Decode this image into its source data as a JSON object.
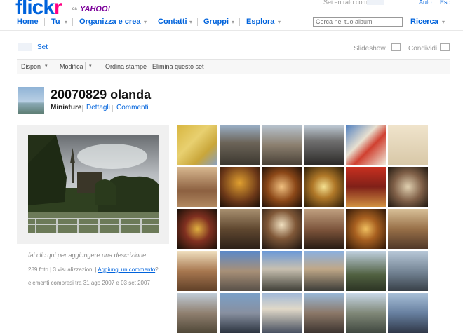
{
  "brand": {
    "logo_main": "flick",
    "logo_accent": "r",
    "logo_partner_prefix": "da",
    "logo_partner": "YAHOO!"
  },
  "account": {
    "signed_in_label": "Sei entrato come",
    "auto_label": "Auto",
    "exit_label": "Esc"
  },
  "nav": {
    "home": "Home",
    "you": "Tu",
    "organize": "Organizza e crea",
    "contacts": "Contatti",
    "groups": "Gruppi",
    "explore": "Esplora"
  },
  "search": {
    "placeholder": "Cerca nel tuo album",
    "button": "Ricerca"
  },
  "breadcrumb": {
    "set_link": "Set"
  },
  "actions": {
    "slideshow": "Slideshow",
    "share": "Condividi"
  },
  "toolbar": {
    "display": "Dispon",
    "edit": "Modifica",
    "order_prints": "Ordina stampe",
    "delete_set": "Elimina questo set"
  },
  "set": {
    "title": "20070829 olanda",
    "tabs": {
      "thumbnails": "Miniature",
      "details": "Dettagli",
      "comments": "Commenti"
    },
    "description_prompt": "fai clic qui per aggiungere una descrizione",
    "stats_prefix": "289 foto | 3 visualizzazioni |",
    "add_comment": "Aggiungi un commento",
    "stats_suffix": "?",
    "date_range": "elementi compresi tra 31 ago 2007 e 03 set 2007"
  },
  "colors": {
    "link_blue": "#0063dc",
    "flickr_pink": "#ff0084",
    "yahoo_purple": "#7b0099"
  },
  "thumbnails": [
    {
      "bg": "linear-gradient(135deg,#d8b640,#e8d070 40%,#c9a63a 70%,#8aa0c0)"
    },
    {
      "bg": "linear-gradient(#9ab0c8 0%,#6c6458 45%,#3c3830 100%)"
    },
    {
      "bg": "linear-gradient(#b8c4d0 0%,#8c8070 50%,#4a4238 100%)"
    },
    {
      "bg": "linear-gradient(#c0ccd8 0%,#707070 40%,#2c2a28 100%)"
    },
    {
      "bg": "linear-gradient(135deg,#5080c0,#e8e0d0 40%,#d04030 60%,#f0e8d8)"
    },
    {
      "bg": "linear-gradient(#f0e4cc,#d8c8a8)"
    },
    {
      "bg": "linear-gradient(#d8b890,#8c6040 60%,#b08860)"
    },
    {
      "bg": "radial-gradient(circle at 50% 40%,#e0a030,#6c3818 60%,#1c1008)"
    },
    {
      "bg": "radial-gradient(circle at 50% 50%,#f0c080,#8c4818 50%,#201008)"
    },
    {
      "bg": "radial-gradient(circle at 50% 50%,#f4e090,#b07828 40%,#2c1c08)"
    },
    {
      "bg": "linear-gradient(#c83020,#802018 50%,#d09040)"
    },
    {
      "bg": "radial-gradient(circle at 50% 50%,#e0d0b0,#806048 50%,#201810)"
    },
    {
      "bg": "radial-gradient(circle at 50% 50%,#e0b040,#803020 45%,#181008)"
    },
    {
      "bg": "linear-gradient(#a89070,#604830 50%,#2c2018)"
    },
    {
      "bg": "radial-gradient(circle at 50% 40%,#f0e0c0,#805838 45%,#1c1410)"
    },
    {
      "bg": "linear-gradient(#c0a080,#785038 55%,#281c14)"
    },
    {
      "bg": "radial-gradient(circle at 50% 50%,#f0c060,#a86020 40%,#301808)"
    },
    {
      "bg": "linear-gradient(#d8c098,#987048 50%,#503828)"
    },
    {
      "bg": "linear-gradient(#f0e0c0,#a87850 50%,#604028)"
    },
    {
      "bg": "linear-gradient(#5a88c8 0%,#a89078 50%,#585048 100%)"
    },
    {
      "bg": "linear-gradient(#6a98d8 0%,#c8c0b0 45%,#404038 100%)"
    },
    {
      "bg": "linear-gradient(#8ab0e0 0%,#c0a888 45%,#3c3c38 100%)"
    },
    {
      "bg": "linear-gradient(#c0d0e0 0%,#506040 60%,#2c3424 100%)"
    },
    {
      "bg": "linear-gradient(#b8c8d8 0%,#708090 55%,#384048 100%)"
    },
    {
      "bg": "linear-gradient(#c0ccd8 0%,#908070 50%,#504838 100%)"
    },
    {
      "bg": "linear-gradient(#7aa0c8 0%,#8890a0 50%,#2c3440 100%)"
    },
    {
      "bg": "linear-gradient(#a0b8d8 0%,#e0d8c8 40%,#485060 100%)"
    },
    {
      "bg": "linear-gradient(#98b8d8 0%,#8c7868 50%,#3c3430 100%)"
    },
    {
      "bg": "linear-gradient(#c8d8e8 0%,#808878 50%,#404840 100%)"
    },
    {
      "bg": "linear-gradient(#a8c0d8 0%,#6880a0 50%,#303848 100%)"
    }
  ]
}
